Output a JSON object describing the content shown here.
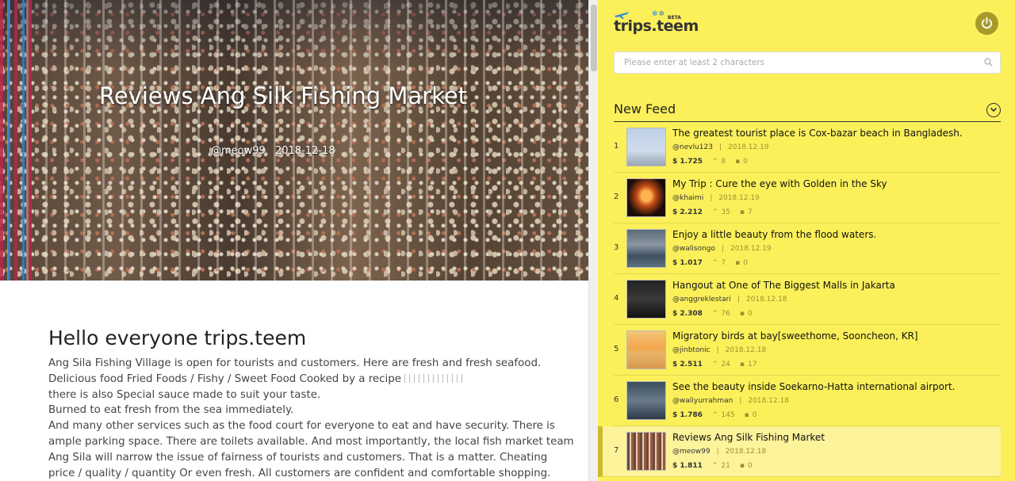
{
  "article": {
    "title": "Reviews Ang Silk Fishing Market",
    "author": "@meow99",
    "date": "2018-12-18",
    "heading": "Hello everyone trips.teem",
    "lines": [
      "Ang Sila Fishing Village is open for tourists and customers. Here are fresh and fresh seafood.",
      "Delicious food Fried Foods / Fishy / Sweet Food Cooked by a recipe",
      "there is also Special sauce made to suit your taste.",
      "Burned to eat fresh from the sea immediately.",
      "And many other services such as the food court for everyone to eat and have security. There is",
      "ample parking space. There are toilets available. And most importantly, the local fish market team",
      "Ang Sila will narrow the issue of fairness of tourists and customers. That is a matter. Cheating",
      "price / quality / quantity Or even fresh. All customers are confident and comfortable shopping."
    ]
  },
  "panel": {
    "logo_text": "trips.teem",
    "logo_badge": "BETA",
    "search_placeholder": "Please enter at least 2 characters",
    "feed_title": "New Feed",
    "colors": {
      "panel_bg": "#fbf05a",
      "accent": "#a89a2a",
      "active_row": "#fdf39a"
    },
    "feed": [
      {
        "rank": "1",
        "title": "The greatest tourist place is Cox-bazar beach in Bangladesh.",
        "author": "@nevlu123",
        "date": "2018.12.19",
        "payout": "$ 1.725",
        "votes": "8",
        "comments": "0"
      },
      {
        "rank": "2",
        "title": "My Trip : Cure the eye with Golden in the Sky",
        "author": "@khaimi",
        "date": "2018.12.19",
        "payout": "$ 2.212",
        "votes": "35",
        "comments": "7"
      },
      {
        "rank": "3",
        "title": "Enjoy a little beauty from the flood waters.",
        "author": "@walisongo",
        "date": "2018.12.19",
        "payout": "$ 1.017",
        "votes": "7",
        "comments": "0"
      },
      {
        "rank": "4",
        "title": "Hangout at One of The Biggest Malls in Jakarta",
        "author": "@anggreklestari",
        "date": "2018.12.18",
        "payout": "$ 2.308",
        "votes": "76",
        "comments": "0"
      },
      {
        "rank": "5",
        "title": "Migratory birds at bay[sweethome, Sooncheon, KR]",
        "author": "@jinbtonic",
        "date": "2018.12.18",
        "payout": "$ 2.511",
        "votes": "24",
        "comments": "17"
      },
      {
        "rank": "6",
        "title": "See the beauty inside Soekarno-Hatta international airport.",
        "author": "@waliyurrahman",
        "date": "2018.12.18",
        "payout": "$ 1.786",
        "votes": "145",
        "comments": "0"
      },
      {
        "rank": "7",
        "title": "Reviews Ang Silk Fishing Market",
        "author": "@meow99",
        "date": "2018.12.18",
        "payout": "$ 1.811",
        "votes": "21",
        "comments": "0"
      }
    ]
  }
}
